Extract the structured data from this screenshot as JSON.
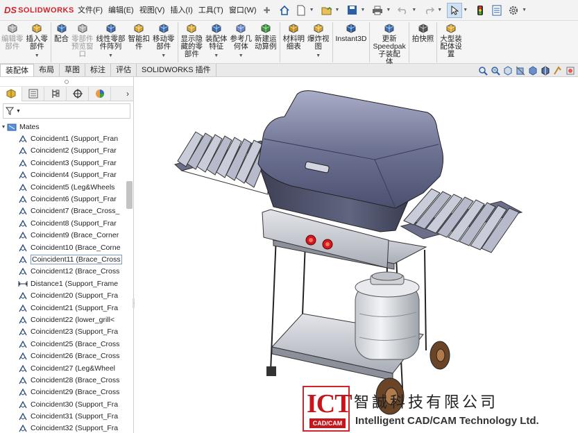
{
  "app": {
    "brand_prefix": "DS",
    "brand": "SOLIDWORKS"
  },
  "menu": [
    "文件(F)",
    "编辑(E)",
    "视图(V)",
    "插入(I)",
    "工具(T)",
    "窗口(W)"
  ],
  "commands": [
    {
      "label": "编辑零\n部件",
      "icon": "edit-component-icon",
      "disabled": true,
      "dropdown": false
    },
    {
      "label": "插入零\n部件",
      "icon": "insert-component-icon",
      "disabled": false,
      "dropdown": true
    },
    {
      "label": "配合",
      "icon": "mate-icon",
      "disabled": false,
      "dropdown": false
    },
    {
      "label": "零部件\n预览窗\n口",
      "icon": "component-preview-icon",
      "disabled": true,
      "dropdown": false
    },
    {
      "label": "线性零部\n件阵列",
      "icon": "linear-pattern-icon",
      "disabled": false,
      "dropdown": true
    },
    {
      "label": "智能扣\n件",
      "icon": "smart-fasteners-icon",
      "disabled": false,
      "dropdown": false
    },
    {
      "label": "移动零\n部件",
      "icon": "move-component-icon",
      "disabled": false,
      "dropdown": true
    },
    {
      "label": "显示隐\n藏的零\n部件",
      "icon": "show-hidden-icon",
      "disabled": false,
      "dropdown": false
    },
    {
      "label": "装配体\n特征",
      "icon": "assembly-features-icon",
      "disabled": false,
      "dropdown": true
    },
    {
      "label": "参考几\n何体",
      "icon": "reference-geometry-icon",
      "disabled": false,
      "dropdown": true
    },
    {
      "label": "新建运\n动算例",
      "icon": "new-motion-study-icon",
      "disabled": false,
      "dropdown": false
    },
    {
      "label": "材料明\n细表",
      "icon": "bom-icon",
      "disabled": false,
      "dropdown": false
    },
    {
      "label": "爆炸视\n图",
      "icon": "exploded-view-icon",
      "disabled": false,
      "dropdown": true
    },
    {
      "label": "Instant3D",
      "icon": "instant3d-icon",
      "disabled": false,
      "dropdown": false
    },
    {
      "label": "更新\nSpeedpak\n子装配\n体",
      "icon": "speedpak-icon",
      "disabled": false,
      "dropdown": false
    },
    {
      "label": "拍快照",
      "icon": "snapshot-icon",
      "disabled": false,
      "dropdown": false
    },
    {
      "label": "大型装\n配体设\n置",
      "icon": "large-assembly-icon",
      "disabled": false,
      "dropdown": false
    }
  ],
  "tabs": [
    "装配体",
    "布局",
    "草图",
    "标注",
    "评估",
    "SOLIDWORKS 插件"
  ],
  "active_tab": 0,
  "tree": {
    "root_label": "Mates",
    "items": [
      {
        "label": "Coincident1 (Support_Fran",
        "type": "coincident"
      },
      {
        "label": "Coincident2 (Support_Frar",
        "type": "coincident"
      },
      {
        "label": "Coincident3 (Support_Frar",
        "type": "coincident"
      },
      {
        "label": "Coincident4 (Support_Frar",
        "type": "coincident"
      },
      {
        "label": "Coincident5 (Leg&Wheels",
        "type": "coincident"
      },
      {
        "label": "Coincident6 (Support_Frar",
        "type": "coincident"
      },
      {
        "label": "Coincident7 (Brace_Cross_",
        "type": "coincident"
      },
      {
        "label": "Coincident8 (Support_Frar",
        "type": "coincident"
      },
      {
        "label": "Coincident9 (Brace_Corner",
        "type": "coincident"
      },
      {
        "label": "Coincident10 (Brace_Corne",
        "type": "coincident"
      },
      {
        "label": "Coincident11 (Brace_Cross",
        "type": "coincident",
        "selected": true
      },
      {
        "label": "Coincident12 (Brace_Cross",
        "type": "coincident"
      },
      {
        "label": "Distance1 (Support_Frame",
        "type": "distance"
      },
      {
        "label": "Coincident20 (Support_Fra",
        "type": "coincident"
      },
      {
        "label": "Coincident21 (Support_Fra",
        "type": "coincident"
      },
      {
        "label": "Coincident22 (lower_grill<",
        "type": "coincident"
      },
      {
        "label": "Coincident23 (Support_Fra",
        "type": "coincident"
      },
      {
        "label": "Coincident25 (Brace_Cross",
        "type": "coincident"
      },
      {
        "label": "Coincident26 (Brace_Cross",
        "type": "coincident"
      },
      {
        "label": "Coincident27 (Leg&Wheel",
        "type": "coincident"
      },
      {
        "label": "Coincident28 (Brace_Cross",
        "type": "coincident"
      },
      {
        "label": "Coincident29 (Brace_Cross",
        "type": "coincident"
      },
      {
        "label": "Coincident30 (Support_Fra",
        "type": "coincident"
      },
      {
        "label": "Coincident31 (Support_Fra",
        "type": "coincident"
      },
      {
        "label": "Coincident32 (Support_Fra",
        "type": "coincident"
      }
    ]
  },
  "watermark": {
    "logo": "ICT",
    "logo_sub": "CAD/CAM",
    "company_cn": "智誠科技有限公司",
    "company_en": "Intelligent CAD/CAM Technology Ltd."
  },
  "colors": {
    "brand_red": "#d2232a",
    "selection_blue": "#cfe0f3"
  }
}
